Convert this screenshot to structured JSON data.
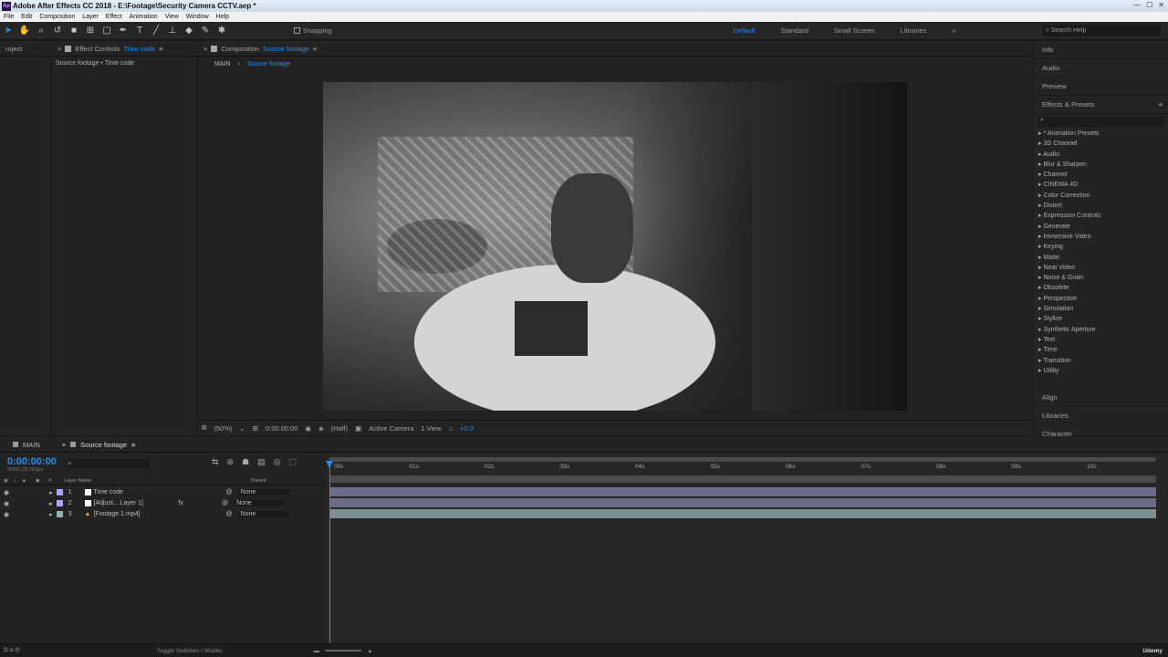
{
  "title_bar": {
    "text": "Adobe After Effects CC 2018 - E:\\Footage\\Security Camera CCTV.aep *"
  },
  "menu": [
    "File",
    "Edit",
    "Composition",
    "Layer",
    "Effect",
    "Animation",
    "View",
    "Window",
    "Help"
  ],
  "toolbar": {
    "snapping": "Snapping",
    "workspaces": [
      "Default",
      "Standard",
      "Small Screen",
      "Libraries"
    ],
    "search_placeholder": "Search Help"
  },
  "project_panel": {
    "tab": "roject"
  },
  "effect_controls": {
    "tab_prefix": "Effect Controls",
    "tab_layer": "Time code",
    "breadcrumb": "Source footage • Time code"
  },
  "composition_panel": {
    "tab_prefix": "Composition",
    "tab_comp": "Source footage",
    "crumbs": [
      "MAIN",
      "Source footage"
    ]
  },
  "viewer_footer": {
    "zoom": "(50%)",
    "timecode": "0:00:00:00",
    "resolution": "(Half)",
    "camera": "Active Camera",
    "views": "1 View",
    "exposure": "+0.0"
  },
  "right_panel": {
    "items_top": [
      "Info",
      "Audio",
      "Preview"
    ],
    "effects_presets": {
      "title": "Effects & Presets",
      "search_placeholder": "",
      "categories": [
        "* Animation Presets",
        "3D Channel",
        "Audio",
        "Blur & Sharpen",
        "Channel",
        "CINEMA 4D",
        "Color Correction",
        "Distort",
        "Expression Controls",
        "Generate",
        "Immersive Video",
        "Keying",
        "Matte",
        "Neat Video",
        "Noise & Grain",
        "Obsolete",
        "Perspective",
        "Simulation",
        "Stylize",
        "Synthetic Aperture",
        "Text",
        "Time",
        "Transition",
        "Utility"
      ]
    },
    "items_bottom": [
      "Align",
      "Libraries",
      "Character"
    ]
  },
  "timeline": {
    "tabs": [
      "MAIN",
      "Source footage"
    ],
    "current_time": "0:00:00:00",
    "sub_time": "00000 (25.00 fps)",
    "columns": {
      "layer_name": "Layer Name",
      "parent": "Parent"
    },
    "layers": [
      {
        "num": "1",
        "name": "Time code",
        "parent": "None",
        "fx": ""
      },
      {
        "num": "2",
        "name": "[Adjust... Layer 1]",
        "parent": "None",
        "fx": "fx"
      },
      {
        "num": "3",
        "name": "[Footage 1.mp4]",
        "parent": "None",
        "fx": ""
      }
    ],
    "ruler": [
      "00s",
      "01s",
      "02s",
      "03s",
      "04s",
      "05s",
      "06s",
      "07s",
      "08s",
      "09s",
      "10s"
    ],
    "colors": {
      "bar": "#6c6c86",
      "bar_footage": "#7d8f8f",
      "accent": "#2d8ceb"
    }
  },
  "status": {
    "toggle": "Toggle Switches / Modes",
    "brand": "Udemy"
  }
}
